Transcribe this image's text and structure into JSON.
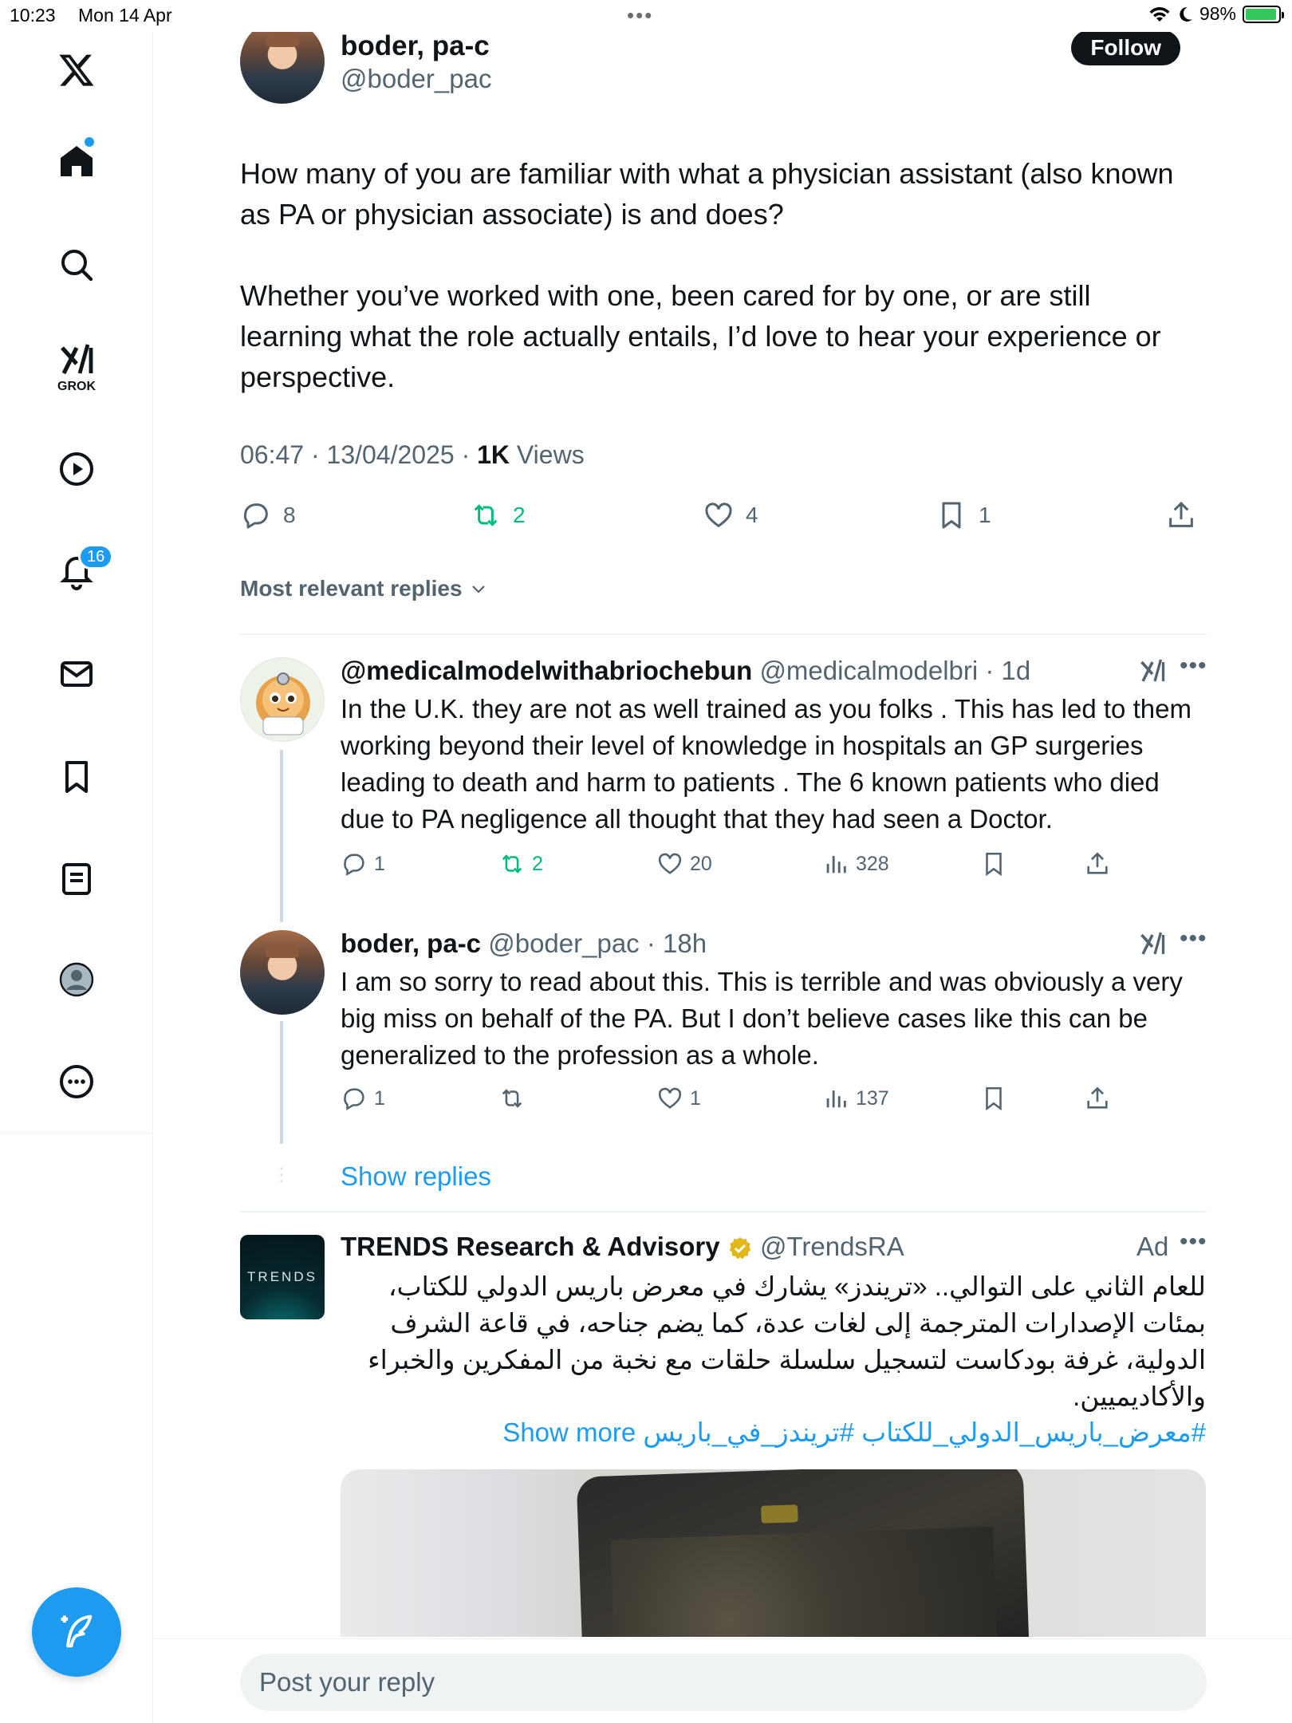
{
  "status_bar": {
    "time": "10:23",
    "date": "Mon 14 Apr",
    "battery": "98%"
  },
  "sidebar": {
    "grok_label": "GROK",
    "notification_count": "16",
    "items": [
      "home",
      "explore",
      "grok",
      "video",
      "notifications",
      "messages",
      "bookmarks",
      "lists",
      "profile",
      "more"
    ]
  },
  "post": {
    "author_name": "boder, pa-c",
    "author_handle": "@boder_pac",
    "follow_label": "Follow",
    "paragraph_1": "How many of you are familiar with what a physician assistant (also known as PA or physician associate) is and does?",
    "paragraph_2": "Whether you’ve worked with one, been cared for by one, or are still learning what the role actually entails, I’d love to hear your experience or perspective.",
    "time": "06:47",
    "date": "13/04/2025",
    "views_count": "1K",
    "views_label": "Views",
    "replies": "8",
    "reposts": "2",
    "likes": "4",
    "bookmarks": "1"
  },
  "sort_label": "Most relevant replies",
  "replies": [
    {
      "name": "@medicalmodelwithabriochebun",
      "handle": "@medicalmodelbri",
      "age": "1d",
      "text": "In the U.K. they are not as well trained as you folks . This has led to them working beyond their level of knowledge in hospitals an GP surgeries leading to death and harm to patients . The 6 known patients who died due to PA negligence all thought that they had seen a Doctor.",
      "replies": "1",
      "reposts": "2",
      "likes": "20",
      "views": "328"
    },
    {
      "name": "boder, pa-c",
      "handle": "@boder_pac",
      "age": "18h",
      "text": "I am so sorry to read about this. This is terrible and was obviously a very big miss on behalf of the PA. But I don’t believe cases like this can be generalized to the profession as a whole.",
      "replies": "1",
      "reposts": "",
      "likes": "1",
      "views": "137"
    }
  ],
  "show_replies_label": "Show replies",
  "ad": {
    "name": "TRENDS Research & Advisory",
    "handle": "@TrendsRA",
    "ad_label": "Ad",
    "logo_text": "TRENDS",
    "text": "للعام الثاني على التوالي.. «تريندز» يشارك في معرض باريس الدولي للكتاب، بمئات الإصدارات المترجمة إلى لغات عدة، كما يضم جناحه، في قاعة الشرف الدولية، غرفة بودكاست لتسجيل سلسلة حلقات مع نخبة من المفكرين والخبراء والأكاديميين.",
    "show_more": "Show more",
    "hashtags": "#معرض_باريس_الدولي_للكتاب #تريندز_في_باريس"
  },
  "reply_box": {
    "placeholder": "Post your reply"
  },
  "colors": {
    "accent": "#1d9bf0",
    "repost_green": "#00ba7c",
    "text": "#0f1419",
    "muted": "#536471"
  }
}
